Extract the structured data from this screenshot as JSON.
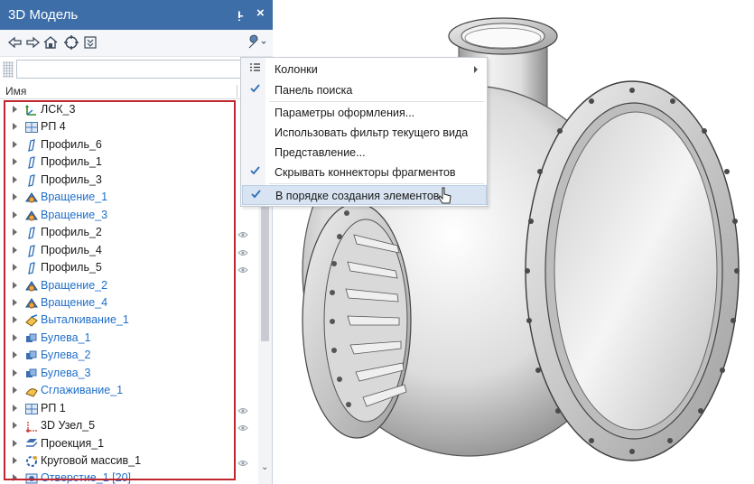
{
  "panel": {
    "title": "3D Модель",
    "pin_glyph": "Ĩ",
    "close_glyph": "×",
    "toolbar": {
      "icons": [
        "back-arrow-icon",
        "forward-arrow-icon",
        "home-icon",
        "target-icon",
        "collapse-icon",
        "wrench-icon"
      ]
    },
    "search": {
      "value": "",
      "placeholder": ""
    },
    "column_name": "Имя",
    "tree": [
      {
        "label": "ЛСК_3",
        "icon": "lcs-axes-icon",
        "blue": false,
        "eye": false
      },
      {
        "label": "РП 4",
        "icon": "plane-grid-icon",
        "blue": false,
        "eye": false
      },
      {
        "label": "Профиль_6",
        "icon": "profile-icon",
        "blue": false,
        "eye": false
      },
      {
        "label": "Профиль_1",
        "icon": "profile-icon",
        "blue": false,
        "eye": false
      },
      {
        "label": "Профиль_3",
        "icon": "profile-icon",
        "blue": false,
        "eye": false
      },
      {
        "label": "Вращение_1",
        "icon": "revolve-icon",
        "blue": true,
        "eye": false
      },
      {
        "label": "Вращение_3",
        "icon": "revolve-icon",
        "blue": true,
        "eye": false
      },
      {
        "label": "Профиль_2",
        "icon": "profile-icon",
        "blue": false,
        "eye": true
      },
      {
        "label": "Профиль_4",
        "icon": "profile-icon",
        "blue": false,
        "eye": true
      },
      {
        "label": "Профиль_5",
        "icon": "profile-icon",
        "blue": false,
        "eye": true
      },
      {
        "label": "Вращение_2",
        "icon": "revolve-icon",
        "blue": true,
        "eye": false
      },
      {
        "label": "Вращение_4",
        "icon": "revolve-icon",
        "blue": true,
        "eye": false
      },
      {
        "label": "Выталкивание_1",
        "icon": "extrude-icon",
        "blue": true,
        "eye": false
      },
      {
        "label": "Булева_1",
        "icon": "boolean-icon",
        "blue": true,
        "eye": false
      },
      {
        "label": "Булева_2",
        "icon": "boolean-icon",
        "blue": true,
        "eye": false
      },
      {
        "label": "Булева_3",
        "icon": "boolean-icon",
        "blue": true,
        "eye": false
      },
      {
        "label": "Сглаживание_1",
        "icon": "smooth-icon",
        "blue": true,
        "eye": false
      },
      {
        "label": "РП 1",
        "icon": "plane-grid-icon",
        "blue": false,
        "eye": true
      },
      {
        "label": "3D Узел_5",
        "icon": "node-3d-icon",
        "blue": false,
        "eye": true
      },
      {
        "label": "Проекция_1",
        "icon": "projection-icon",
        "blue": false,
        "eye": false
      },
      {
        "label": "Круговой массив_1",
        "icon": "circular-array-icon",
        "blue": false,
        "eye": true
      },
      {
        "label": "Отверстие_1 [20]",
        "icon": "hole-icon",
        "blue": true,
        "eye": false
      }
    ]
  },
  "menu": {
    "items": [
      {
        "label": "Колонки",
        "icon": "columns-icon",
        "checked": false,
        "submenu": true,
        "hover": false
      },
      {
        "label": "Панель поиска",
        "icon": "",
        "checked": true,
        "submenu": false,
        "hover": false
      },
      {
        "label": "Параметры оформления...",
        "icon": "",
        "checked": false,
        "submenu": false,
        "hover": false
      },
      {
        "label": "Использовать фильтр текущего вида",
        "icon": "",
        "checked": false,
        "submenu": false,
        "hover": false
      },
      {
        "label": "Представление...",
        "icon": "",
        "checked": false,
        "submenu": false,
        "hover": false
      },
      {
        "label": "Скрывать коннекторы фрагментов",
        "icon": "",
        "checked": true,
        "submenu": false,
        "hover": false
      },
      {
        "label": "В порядке создания элементов",
        "icon": "",
        "checked": true,
        "submenu": false,
        "hover": true
      }
    ]
  },
  "colors": {
    "titlebar": "#3d6ea8",
    "feature_blue": "#1f6fc9",
    "highlight_frame": "#c0262d",
    "menu_hover": "#d8e4f2"
  }
}
